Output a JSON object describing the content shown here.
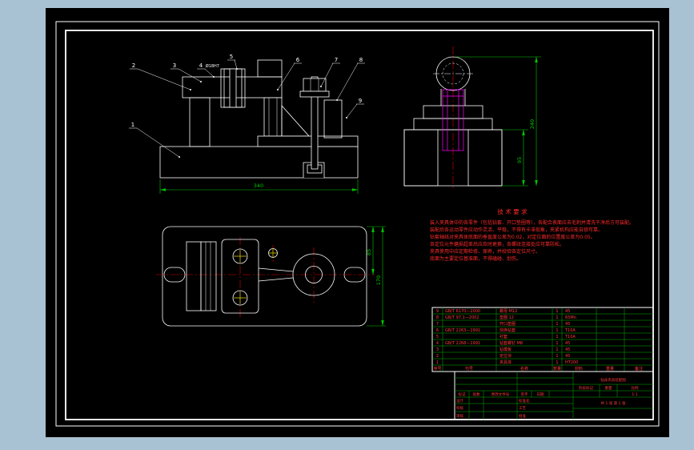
{
  "colors": {
    "background": "#a9c2d3",
    "paper": "#000000",
    "outline": "#ffffff",
    "dimension": "#00c800",
    "centerline": "#e00000",
    "detail_magenta": "#ff00ff",
    "text_red": "#ff3a3a"
  },
  "balloons": [
    "1",
    "2",
    "3",
    "4",
    "5",
    "6",
    "7",
    "8",
    "9"
  ],
  "annotations": {
    "bush_fit": "Ø18H7"
  },
  "dims": {
    "front_width": "340",
    "side_base_height": "95",
    "side_total_height": "240",
    "plan_center_offset": "85",
    "plan_depth": "170"
  },
  "tech": {
    "title": "技 术 要 求",
    "lines": [
      "装入夹具体中的各零件（包括钻套、开口垫圈等），各配合表面应去毛刺并清洗干净后方可装配。",
      "装配后各运动零件应动作灵活、平稳，不得有卡滞现象，夹紧机构应能自锁可靠。",
      "钻套轴线对夹具体底面的垂直度公差为0.02，对定位面的位置度公差为0.05。",
      "各定位元件磨损超差后应及时更换，各螺纹连接处应可靠防松。",
      "夹具使用中应定期检修、保养，并校验各定位尺寸。",
      "底面为主要定位基准面，不得磕碰、划伤。"
    ]
  },
  "bom": {
    "header": {
      "no": "序号",
      "code": "代号",
      "name": "名称",
      "qty": "数量",
      "mat": "材料",
      "weight": "重量",
      "note": "备注"
    },
    "rows": [
      {
        "no": "9",
        "code": "GB/T 6170—2000",
        "name": "螺母 M12",
        "qty": "1",
        "mat": "45"
      },
      {
        "no": "8",
        "code": "GB/T 97.1—2002",
        "name": "垫圈 12",
        "qty": "1",
        "mat": "65Mn"
      },
      {
        "no": "7",
        "code": "",
        "name": "开口垫圈",
        "qty": "1",
        "mat": "45"
      },
      {
        "no": "6",
        "code": "GB/T 2263—1991",
        "name": "快换钻套",
        "qty": "1",
        "mat": "T10A"
      },
      {
        "no": "5",
        "code": "",
        "name": "衬套",
        "qty": "1",
        "mat": "T10A"
      },
      {
        "no": "4",
        "code": "GB/T 2268—1991",
        "name": "钻套螺钉 M8",
        "qty": "1",
        "mat": "45"
      },
      {
        "no": "3",
        "code": "",
        "name": "钻模板",
        "qty": "1",
        "mat": "45"
      },
      {
        "no": "2",
        "code": "",
        "name": "定位块",
        "qty": "1",
        "mat": "45"
      },
      {
        "no": "1",
        "code": "",
        "name": "夹具体",
        "qty": "1",
        "mat": "HT200"
      }
    ]
  },
  "titleblock": {
    "rev_headers": [
      "标记",
      "处数",
      "更改文件号",
      "签字",
      "日期"
    ],
    "roles_left": [
      "设计",
      "校核",
      "审核"
    ],
    "roles_right": [
      "标准化",
      "工艺",
      "批准"
    ],
    "drawing_name": "钻床夹具装配图",
    "stage_label": "阶段标记",
    "weight_label": "重量",
    "scale_label": "比例",
    "scale_value": "1:1",
    "sheet_info": "共 1 张  第 1 张"
  }
}
